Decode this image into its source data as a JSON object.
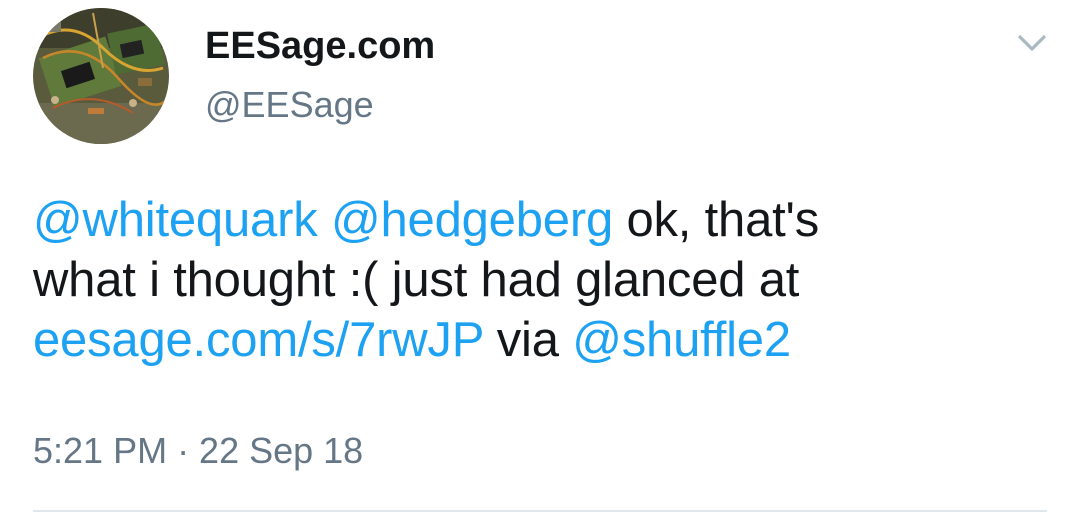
{
  "author": {
    "display_name": "EESage.com",
    "handle": "@EESage"
  },
  "menu": {
    "icon": "chevron-down-icon"
  },
  "tweet": {
    "mention_1": "@whitequark",
    "mention_2": "@hedgeberg",
    "text_1": "ok, that's",
    "text_2": "what i thought :( just had glanced at",
    "link": "eesage.com/s/7rwJP",
    "text_3": "via",
    "mention_3": "@shuffle2"
  },
  "meta": {
    "timestamp": "5:21 PM · 22 Sep 18"
  },
  "colors": {
    "link": "#1da1f2",
    "text": "#14171a",
    "secondary": "#657786",
    "divider": "#e1e8ed"
  }
}
